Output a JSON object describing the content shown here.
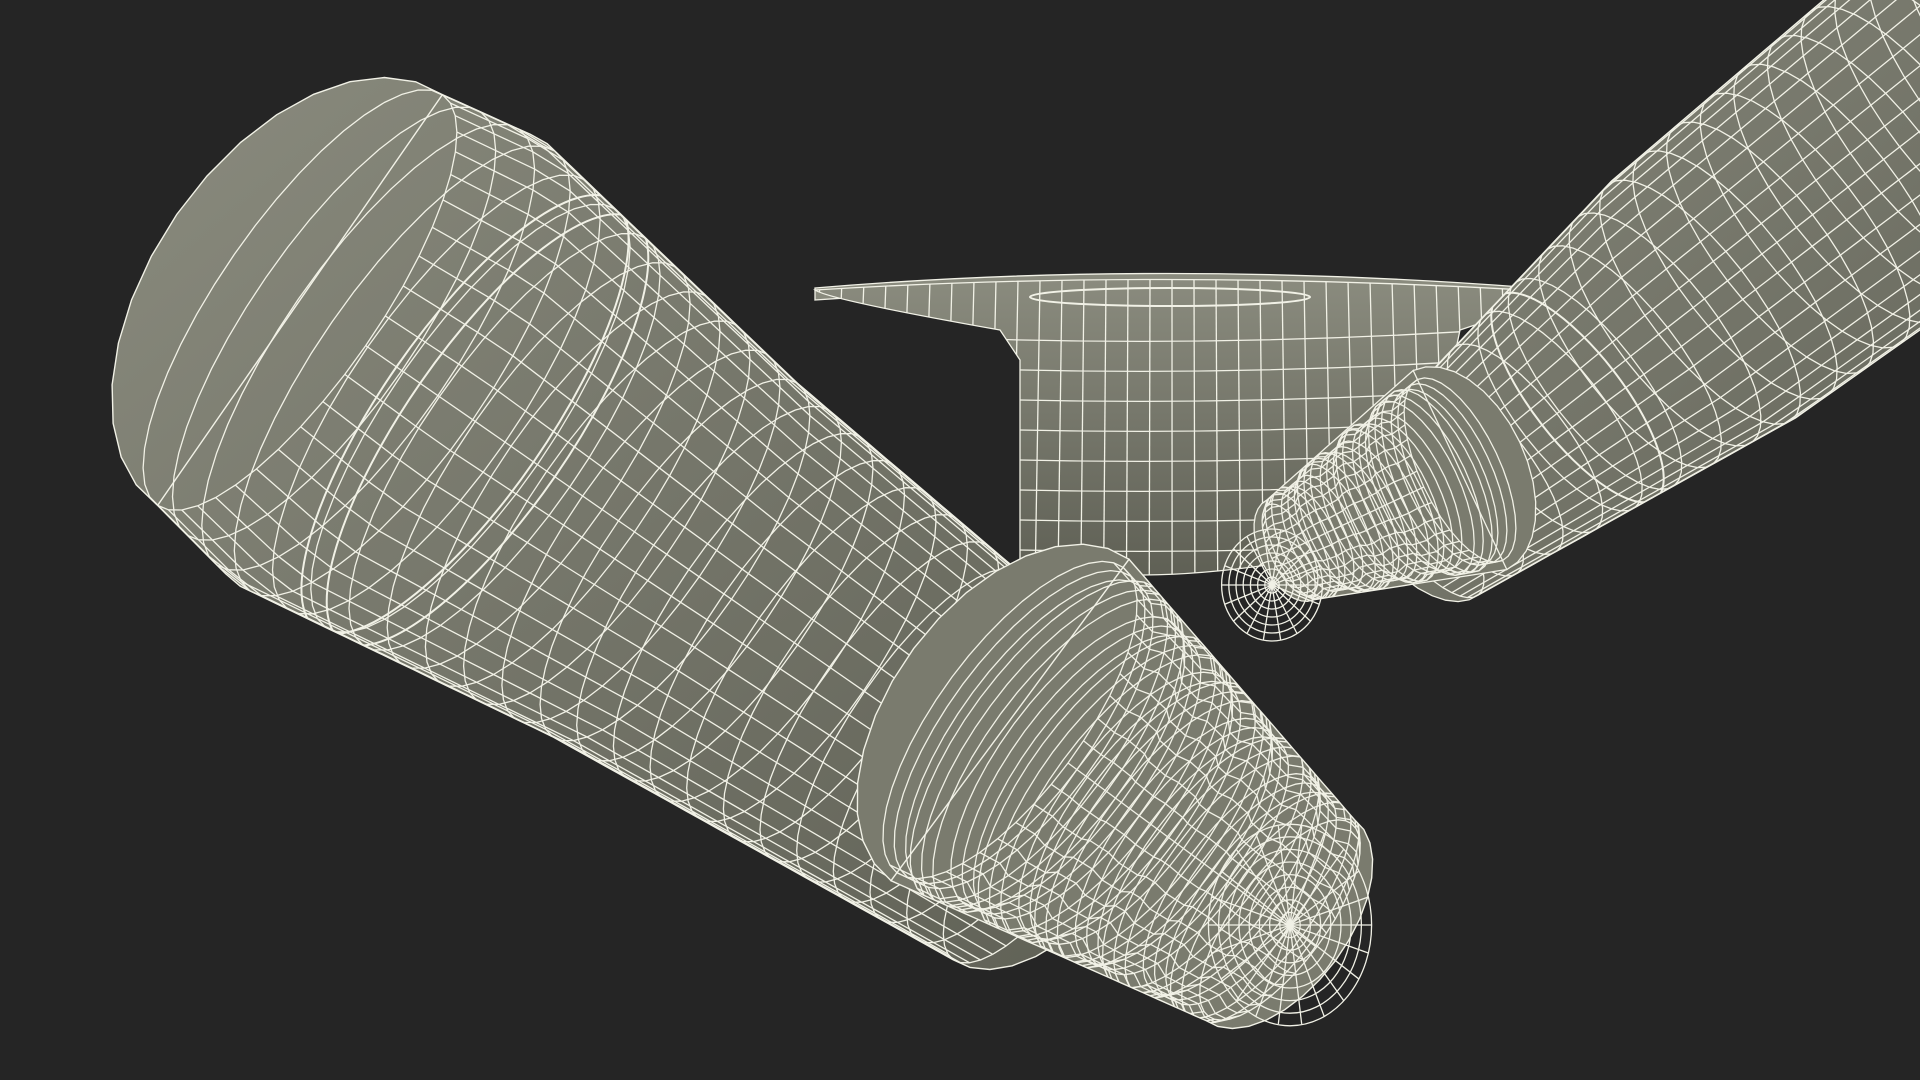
{
  "scene": {
    "background": "#252525",
    "surface_color": "#7a7b6e",
    "surface_shadow": "#5f6055",
    "surface_highlight": "#8a8b7e",
    "wire_color": "#f1f1e6"
  }
}
